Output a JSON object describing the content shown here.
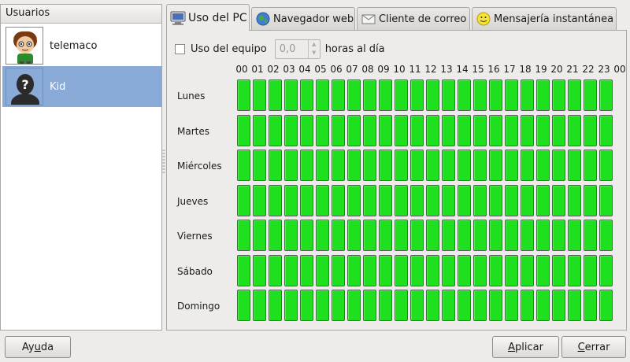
{
  "users_pane": {
    "header": "Usuarios",
    "users": [
      {
        "name": "telemaco",
        "selected": false,
        "avatar": "cartoon-boy-avatar"
      },
      {
        "name": "Kid",
        "selected": true,
        "avatar": "unknown-user-silhouette-avatar"
      }
    ]
  },
  "tabs": [
    {
      "label": "Uso del PC",
      "icon": "computer-icon",
      "active": true
    },
    {
      "label": "Navegador web",
      "icon": "globe-icon",
      "active": false
    },
    {
      "label": "Cliente de correo",
      "icon": "envelope-icon",
      "active": false
    },
    {
      "label": "Mensajería instantánea",
      "icon": "smiley-icon",
      "active": false
    }
  ],
  "usage": {
    "checkbox_label": "Uso del equipo",
    "checked": false,
    "hours_value": "0,0",
    "hours_suffix": "horas al día"
  },
  "schedule": {
    "hours": [
      "00",
      "01",
      "02",
      "03",
      "04",
      "05",
      "06",
      "07",
      "08",
      "09",
      "10",
      "11",
      "12",
      "13",
      "14",
      "15",
      "16",
      "17",
      "18",
      "19",
      "20",
      "21",
      "22",
      "23",
      "00"
    ],
    "days": [
      "Lunes",
      "Martes",
      "Miércoles",
      "Jueves",
      "Viernes",
      "Sábado",
      "Domingo"
    ],
    "slot_color": "#1ee01e",
    "all_slots_allowed": true
  },
  "buttons": {
    "help": {
      "pre": "Ay",
      "accel": "u",
      "post": "da"
    },
    "apply": {
      "pre": "",
      "accel": "A",
      "post": "plicar"
    },
    "close": {
      "pre": "",
      "accel": "C",
      "post": "errar"
    }
  }
}
